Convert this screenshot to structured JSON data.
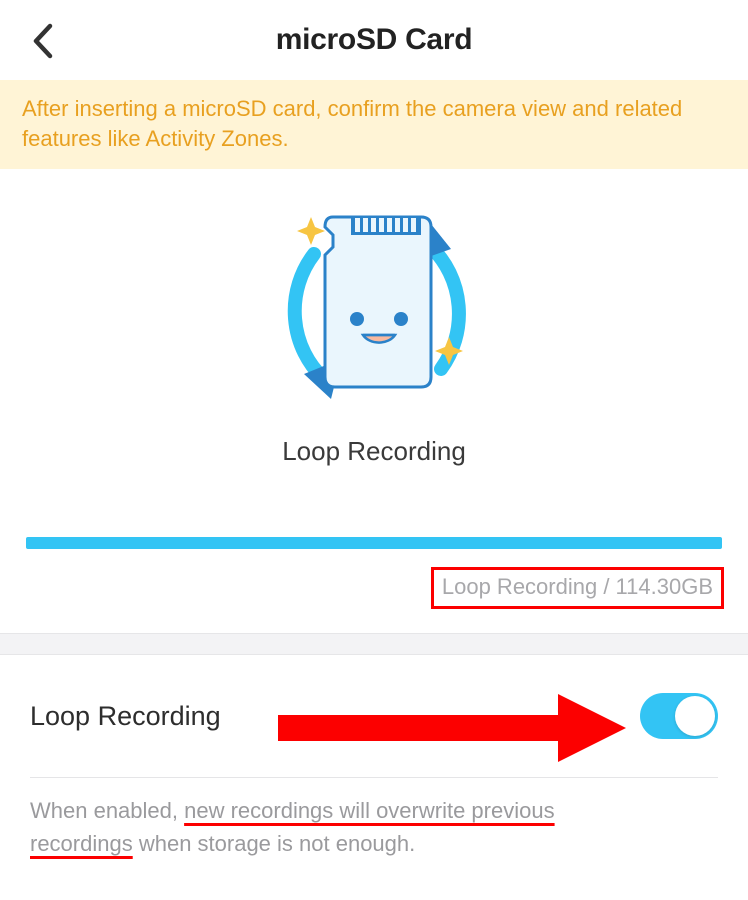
{
  "header": {
    "title": "microSD Card"
  },
  "banner": {
    "text": "After inserting a microSD card, confirm the camera view and related features like Activity Zones."
  },
  "illustration": {
    "caption": "Loop Recording"
  },
  "usage": {
    "label": "Loop Recording / 114.30GB",
    "used_gb": 114.3
  },
  "settings": {
    "loop_recording": {
      "label": "Loop Recording",
      "enabled": true
    }
  },
  "help_text": {
    "prefix": "When enabled, ",
    "emphasis_1": "new recordings will overwrite previous ",
    "emphasis_2": "recordings",
    "suffix": " when storage is not enough."
  },
  "colors": {
    "accent": "#33c4f4",
    "annotation": "#fc0000",
    "banner_bg": "#fff4d6",
    "banner_text": "#e8a020"
  }
}
